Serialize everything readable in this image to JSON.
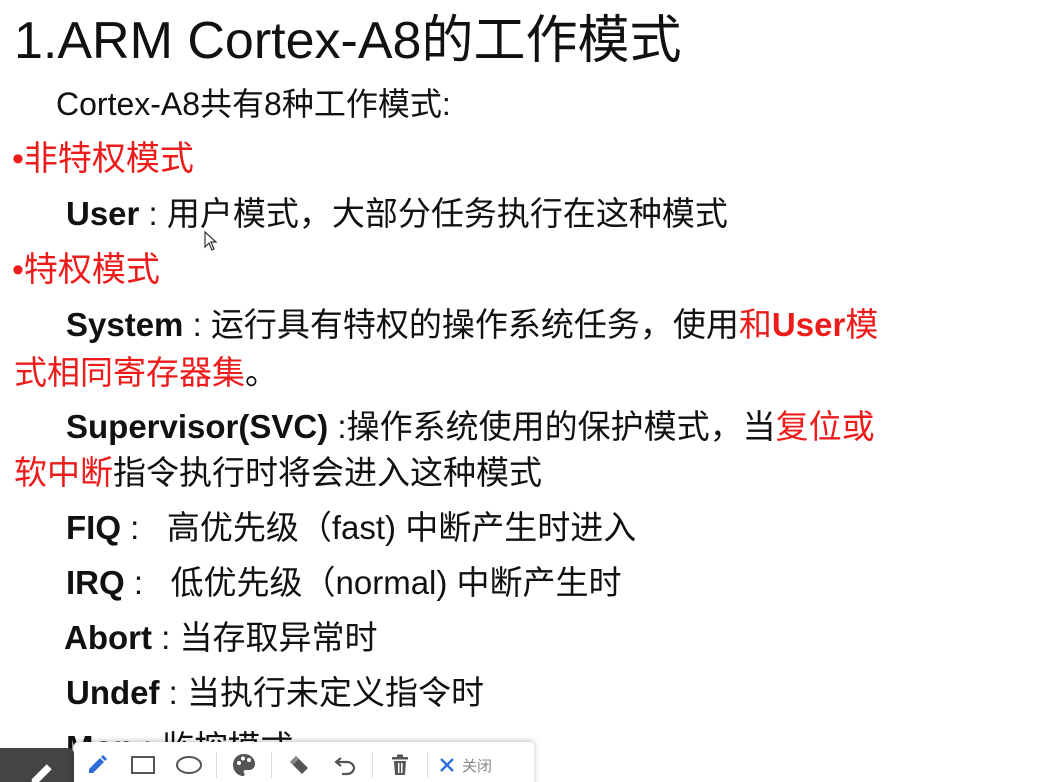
{
  "slide": {
    "title": "1.ARM Cortex-A8的工作模式",
    "intro": "Cortex-A8共有8种工作模式:",
    "non_privileged_heading": "•非特权模式",
    "user": {
      "name": "User",
      "sep": " : ",
      "desc": "用户模式，大部分任务执行在这种模式"
    },
    "privileged_heading": "•特权模式",
    "system": {
      "name": "System",
      "sep": " : ",
      "desc_black": "运行具有特权的操作系统任务，使用",
      "desc_red_1": "和",
      "desc_red_bold": "User",
      "desc_red_2": "模",
      "cont_red": "式相同寄存器集",
      "cont_black": "。"
    },
    "supervisor": {
      "name": "Supervisor(SVC)",
      "sep": " :",
      "desc_black": "操作系统使用的保护模式，当",
      "desc_red": "复位或",
      "cont_red": "软中断",
      "cont_black": "指令执行时将会进入这种模式"
    },
    "fiq": {
      "name": "FIQ",
      "sep": " :   ",
      "desc": "高优先级（fast) 中断产生时进入"
    },
    "irq": {
      "name": "IRQ",
      "sep": " :   ",
      "desc": "低优先级（normal) 中断产生时"
    },
    "abort": {
      "name": "Abort",
      "sep": " : ",
      "desc": "当存取异常时"
    },
    "undef": {
      "name": "Undef",
      "sep": " : ",
      "desc": "当执行未定义指令时"
    },
    "mon": {
      "name": "Mon",
      "sep": " : ",
      "desc": "监控模式"
    }
  },
  "toolbar": {
    "close_label": "关闭",
    "icons": [
      "pen-icon",
      "rectangle-icon",
      "ellipse-icon",
      "palette-icon",
      "eraser-icon",
      "undo-icon",
      "trash-icon",
      "close-icon"
    ]
  },
  "colors": {
    "accent_red": "#ee1b1b",
    "text": "#111111",
    "pen_blue": "#2d6fd6"
  }
}
